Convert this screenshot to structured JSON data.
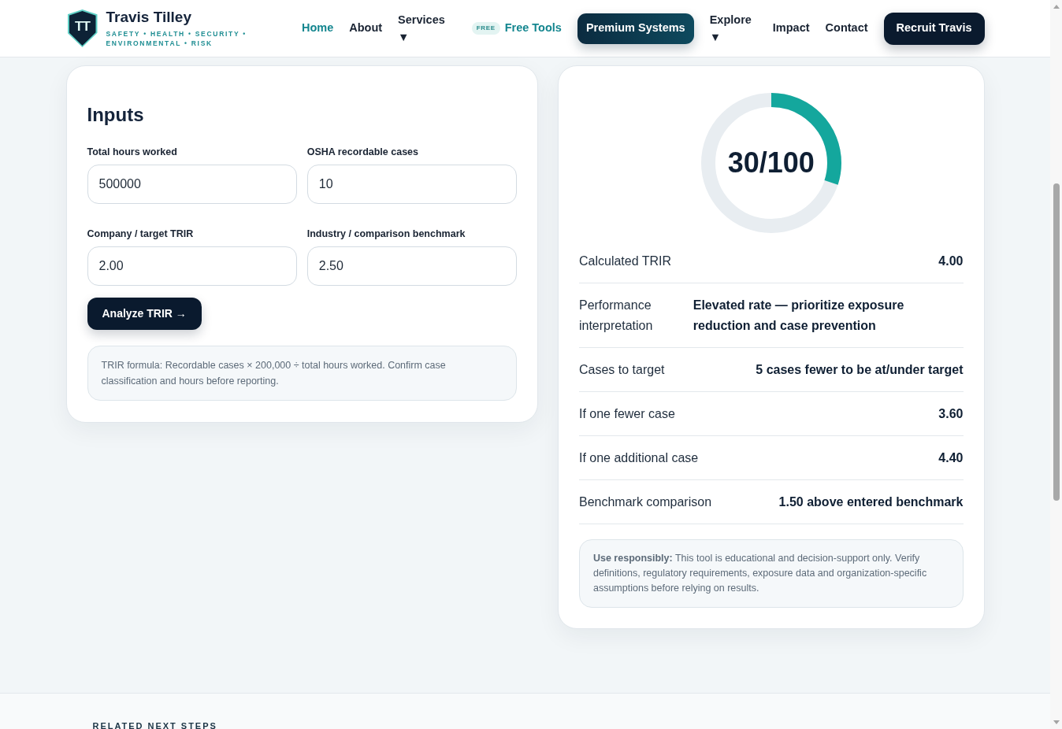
{
  "header": {
    "logo": {
      "monogram": "TT",
      "name": "Travis Tilley",
      "tagline": [
        "SAFETY • HEALTH • SECURITY •",
        "ENVIRONMENTAL • RISK"
      ]
    },
    "nav": [
      {
        "kind": "link",
        "label": "Home",
        "selected": true
      },
      {
        "kind": "link",
        "label": "About",
        "selected": false
      },
      {
        "kind": "dropdown",
        "label": "Services",
        "caret": "▼",
        "selected": false
      },
      {
        "kind": "badge-link",
        "badge": "FREE",
        "label": "Free Tools",
        "selected": true
      },
      {
        "kind": "button-teal",
        "label": "Premium Systems",
        "selected": false
      },
      {
        "kind": "dropdown",
        "label": "Explore",
        "caret": "▼",
        "selected": false
      },
      {
        "kind": "link",
        "label": "Impact",
        "selected": false
      },
      {
        "kind": "link",
        "label": "Contact",
        "selected": false
      },
      {
        "kind": "button-dark",
        "label": "Recruit Travis",
        "selected": false
      }
    ]
  },
  "inputs": {
    "title": "Inputs",
    "fields": [
      {
        "label": "Total hours worked",
        "value": "500000"
      },
      {
        "label": "OSHA recordable cases",
        "value": "10"
      },
      {
        "label": "Company / target TRIR",
        "value": "2.00"
      },
      {
        "label": "Industry / comparison benchmark",
        "value": "2.50"
      }
    ],
    "button": "Analyze TRIR →",
    "note": "TRIR formula: Recordable cases × 200,000 ÷ total hours worked. Confirm case classification and hours before reporting."
  },
  "results": {
    "score": {
      "text": "30/100",
      "level": 0.3
    },
    "rows": [
      {
        "label": "Calculated TRIR",
        "value": "4.00"
      },
      {
        "label": "Performance interpretation",
        "value": "Elevated rate — prioritize exposure reduction and case prevention"
      },
      {
        "label": "Cases to target",
        "value": "5 cases fewer to be at/under target"
      },
      {
        "label": "If one fewer case",
        "value": "3.60"
      },
      {
        "label": "If one additional case",
        "value": "4.40"
      },
      {
        "label": "Benchmark comparison",
        "value": "1.50 above entered benchmark"
      }
    ],
    "note": "**Use responsibly:** This tool is educational and decision-support only. Verify definitions, regulatory requirements, exposure data and organization-specific assumptions before relying on results."
  },
  "footer": {
    "heading": "RELATED NEXT STEPS"
  }
}
